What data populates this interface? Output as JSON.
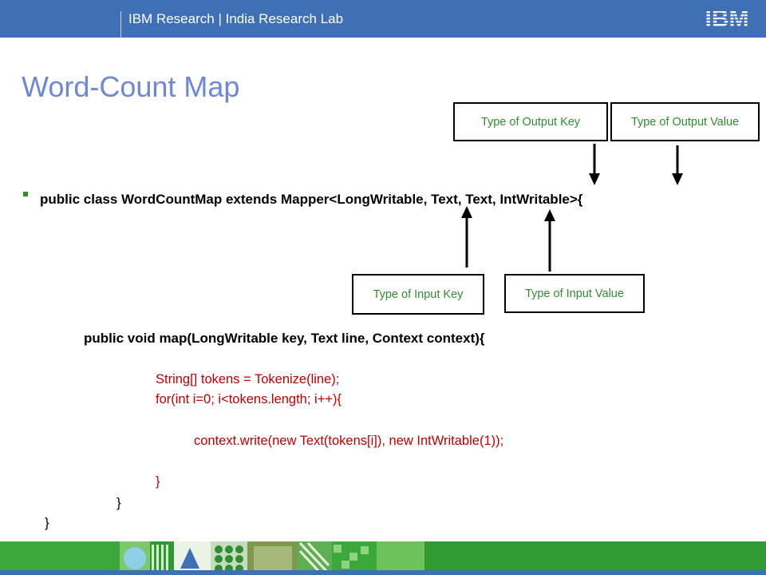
{
  "header": {
    "org": "IBM Research",
    "separator": "|",
    "lab": "India Research Lab",
    "logo_text": "IBM",
    "bg_color": "#3f6fb5"
  },
  "slide": {
    "title": "Word-Count Map",
    "class_declaration": "public class WordCountMap extends Mapper<LongWritable, Text, Text, IntWritable>{",
    "annotations": {
      "output_key": "Type of Output Key",
      "output_value": "Type of Output Value",
      "input_key": "Type of Input Key",
      "input_value": "Type of Input Value"
    },
    "method_signature": "public void map(LongWritable key, Text line, Context context){",
    "code": {
      "line1": "String[] tokens = Tokenize(line);",
      "line2": "for(int i=0; i<tokens.length; i++){",
      "line3": "context.write(new Text(tokens[i]), new IntWritable(1));",
      "line4": "}",
      "close_method": "}",
      "close_class": "}"
    }
  },
  "colors": {
    "title": "#6e87d6",
    "annotation_text": "#2f8f2f",
    "code_text": "#c00000",
    "bullet": "#2f8f2f"
  },
  "icons": {
    "bullet": "square-bullet-icon",
    "logo": "ibm-logo-icon"
  }
}
